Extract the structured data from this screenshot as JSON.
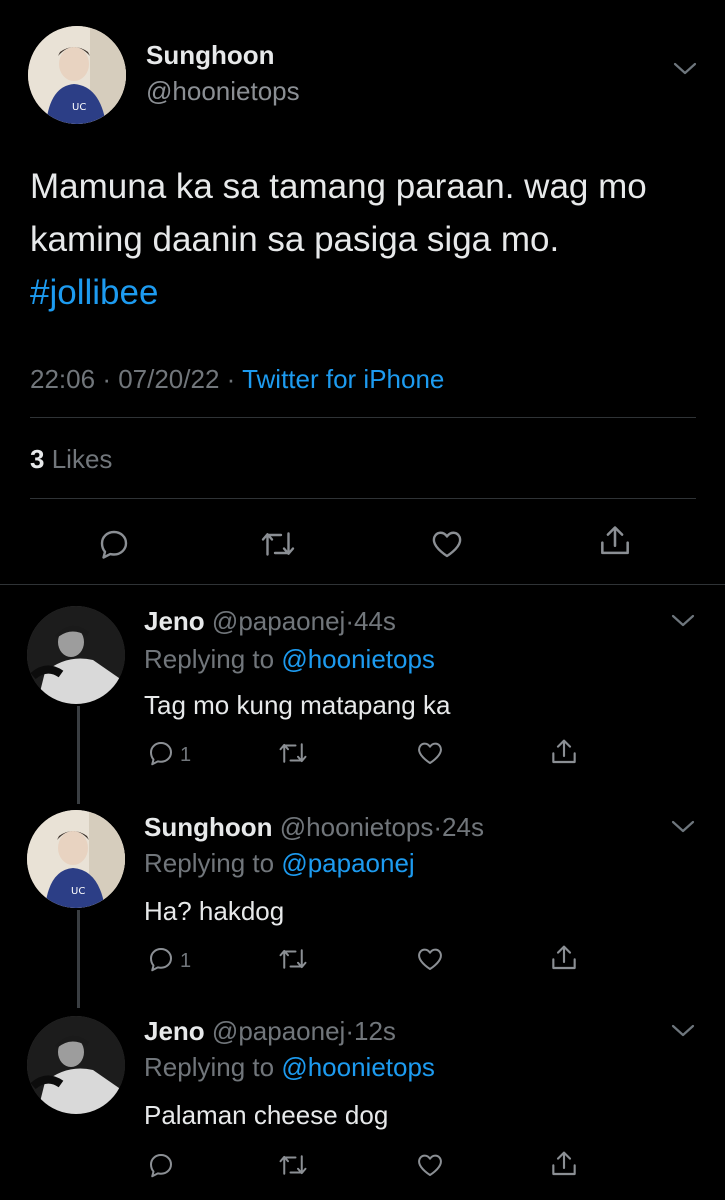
{
  "main_tweet": {
    "author_name": "Sunghoon",
    "author_handle": "@hoonietops",
    "text": "Mamuna ka sa tamang paraan. wag mo kaming daanin sa pasiga siga mo.",
    "hashtag": "#jollibee",
    "time": "22:06",
    "date": "07/20/22",
    "source": "Twitter for iPhone",
    "likes_count": "3",
    "likes_label": "Likes"
  },
  "replies": [
    {
      "name": "Jeno",
      "handle": "@papaonej",
      "age": "44s",
      "replying_label": "Replying to",
      "replying_to": "@hoonietops",
      "text": "Tag mo kung matapang ka",
      "reply_count": "1"
    },
    {
      "name": "Sunghoon",
      "handle": "@hoonietops",
      "age": "24s",
      "replying_label": "Replying to",
      "replying_to": "@papaonej",
      "text": "Ha? hakdog",
      "reply_count": "1"
    },
    {
      "name": "Jeno",
      "handle": "@papaonej",
      "age": "12s",
      "replying_label": "Replying to",
      "replying_to": "@hoonietops",
      "text": "Palaman cheese dog",
      "reply_count": ""
    }
  ],
  "icons": [
    "reply-icon",
    "retweet-icon",
    "like-icon",
    "share-icon",
    "chevron-down-icon"
  ],
  "colors": {
    "background": "#000000",
    "accent": "#1d9bf0",
    "muted": "#71767b",
    "text": "#e7e9ea"
  }
}
